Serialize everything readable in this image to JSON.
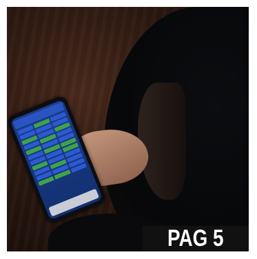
{
  "badge": {
    "label": "PAG 5"
  },
  "colors": {
    "badge_bg": "#111111",
    "badge_text": "#ffffff",
    "screen_blue": "#1b3c8f",
    "screen_green": "#3ea34b"
  }
}
